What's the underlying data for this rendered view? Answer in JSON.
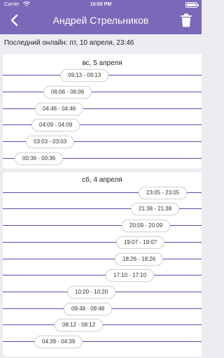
{
  "status_bar": {
    "carrier": "Carrier",
    "time": "10:50 PM"
  },
  "header": {
    "title": "Андрей Стрельников",
    "accent": "#7a68b8"
  },
  "last_online": "Последний онлайн: пт, 10 апреля, 23:46",
  "days": [
    {
      "date": "вс, 5 апреля",
      "sessions": [
        "09:13 - 09:13",
        "06:06 - 06:06",
        "04:46 - 04:46",
        "04:09 - 04:09",
        "03:03 - 03:03",
        "00:36 - 00:36"
      ]
    },
    {
      "date": "сб, 4 апреля",
      "sessions": [
        "23:05 - 23:05",
        "21:38 - 21:38",
        "20:09 - 20:09",
        "19:07 - 19:07",
        "18:26 - 18:26",
        "17:10 - 17:10",
        "10:20 - 10:20",
        "09:48 - 09:48",
        "08:12 - 08:12",
        "04:39 - 04:39"
      ]
    }
  ]
}
